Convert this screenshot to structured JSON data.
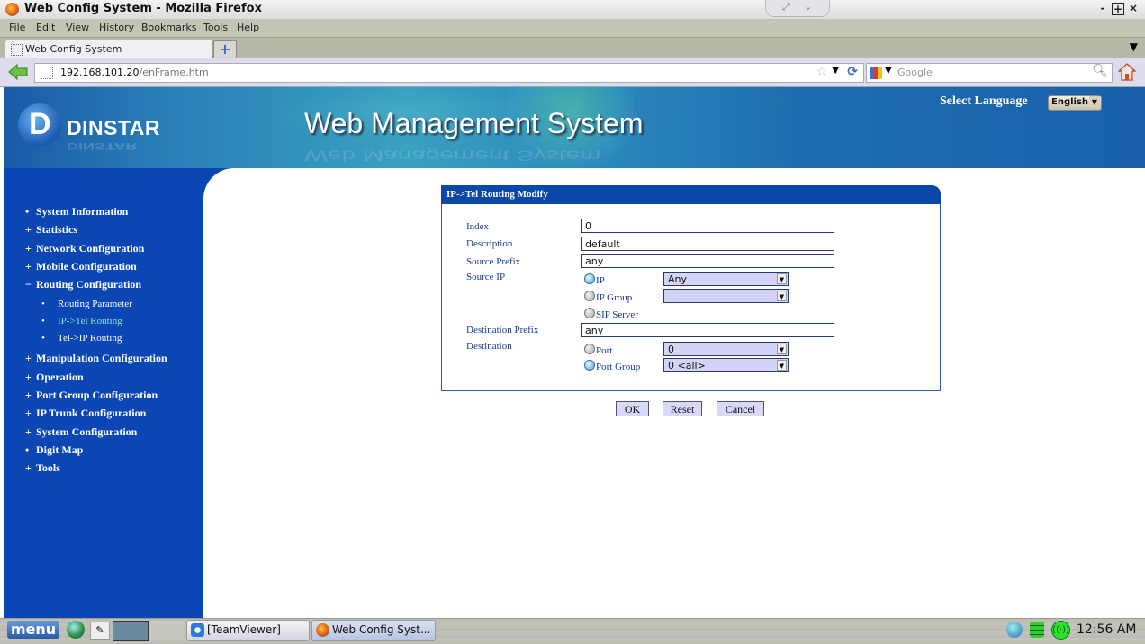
{
  "window": {
    "title": "Web Config System - Mozilla Firefox",
    "controls": {
      "minimize": "-",
      "maximize": "+",
      "close": "×"
    }
  },
  "menubar": {
    "items": [
      {
        "label": "File",
        "accel": "F"
      },
      {
        "label": "Edit",
        "accel": "E"
      },
      {
        "label": "View",
        "accel": "V"
      },
      {
        "label": "History",
        "accel": "s"
      },
      {
        "label": "Bookmarks",
        "accel": "B"
      },
      {
        "label": "Tools",
        "accel": "T"
      },
      {
        "label": "Help",
        "accel": "H"
      }
    ]
  },
  "tabs": {
    "active_label": "Web Config System",
    "new_tab": "+",
    "list_arrow": "▼"
  },
  "navbar": {
    "url_host": "192.168.101.20",
    "url_path": "/enFrame.htm",
    "search_placeholder": "Google"
  },
  "header": {
    "brand": "DINSTAR",
    "title": "Web Management System",
    "language_label": "Select Language",
    "language_value": "English"
  },
  "sidebar": {
    "items": [
      {
        "bullet": "•",
        "label": "System Information"
      },
      {
        "bullet": "+",
        "label": "Statistics"
      },
      {
        "bullet": "+",
        "label": "Network Configuration"
      },
      {
        "bullet": "+",
        "label": "Mobile Configuration"
      },
      {
        "bullet": "−",
        "label": "Routing Configuration"
      },
      {
        "bullet": "+",
        "label": "Manipulation Configuration"
      },
      {
        "bullet": "+",
        "label": "Operation"
      },
      {
        "bullet": "+",
        "label": "Port Group Configuration"
      },
      {
        "bullet": "+",
        "label": "IP Trunk Configuration"
      },
      {
        "bullet": "+",
        "label": "System Configuration"
      },
      {
        "bullet": "•",
        "label": "Digit Map"
      },
      {
        "bullet": "+",
        "label": "Tools"
      }
    ],
    "routing_sub": [
      {
        "bullet": "•",
        "label": "Routing Parameter",
        "active": false
      },
      {
        "bullet": "•",
        "label": "IP->Tel Routing",
        "active": true
      },
      {
        "bullet": "•",
        "label": "Tel->IP Routing",
        "active": false
      }
    ]
  },
  "form": {
    "title": "IP->Tel Routing Modify",
    "labels": {
      "index": "Index",
      "description": "Description",
      "source_prefix": "Source Prefix",
      "source_ip": "Source IP",
      "destination_prefix": "Destination Prefix",
      "destination": "Destination"
    },
    "values": {
      "index": "0",
      "description": "default",
      "source_prefix": "any",
      "destination_prefix": "any"
    },
    "source_ip_options": {
      "ip": {
        "label": "IP",
        "selected": true,
        "select_value": "Any"
      },
      "ip_group": {
        "label": "IP Group",
        "selected": false,
        "select_value": ""
      },
      "sip_server": {
        "label": "SIP Server",
        "selected": false
      }
    },
    "destination_options": {
      "port": {
        "label": "Port",
        "selected": false,
        "select_value": "0"
      },
      "port_group": {
        "label": "Port Group",
        "selected": true,
        "select_value": "0 <all>"
      }
    },
    "buttons": {
      "ok": "OK",
      "reset": "Reset",
      "cancel": "Cancel"
    }
  },
  "taskbar": {
    "menu_label": "menu",
    "tasks": [
      {
        "label": "[TeamViewer]"
      },
      {
        "label": "Web Config Syst..."
      }
    ],
    "clock": "12:56 AM"
  }
}
